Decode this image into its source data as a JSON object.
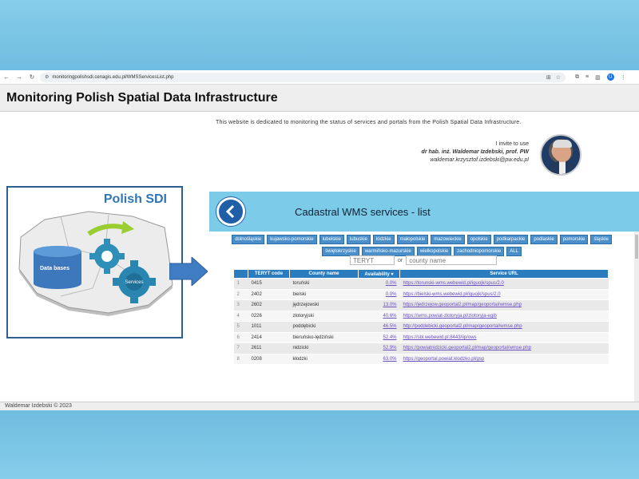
{
  "browser": {
    "url": "monitoringpolishsdi.cenagis.edu.pl/WMSServicesList.php",
    "profile_initial": "U"
  },
  "header": {
    "title": "Monitoring Polish Spatial Data Infrastructure"
  },
  "intro": {
    "text": "This website is dedicated to monitoring the status of services and portals from the Polish Spatial Data Infrastructure.",
    "invite": "I invite to use",
    "author": "dr hab. inż. Waldemar Izdebski, prof. PW",
    "email": "waldemar.krzysztof.izdebski@pw.edu.pl"
  },
  "sdi_graphic": {
    "title": "Polish SDI",
    "databases_label": "Data bases",
    "services_label": "Services"
  },
  "panel": {
    "title": "Cadastral WMS services - list",
    "voivodeships": [
      "dolnośląskie",
      "kujawsko-pomorskie",
      "lubelskie",
      "lubuskie",
      "łódzkie",
      "małopolskie",
      "mazowieckie",
      "opolskie",
      "podkarpackie",
      "podlaskie",
      "pomorskie",
      "śląskie",
      "świętokrzyskie",
      "warmińsko-mazurskie",
      "wielkopolskie",
      "zachodniopomorskie",
      "ALL"
    ],
    "search": {
      "teryt_placeholder": "TERYT",
      "or_label": "or",
      "county_placeholder": "county name"
    },
    "columns": [
      "",
      "TERYT code",
      "County name",
      "Availability ▾",
      "Service URL"
    ],
    "rows": [
      {
        "n": "1",
        "teryt": "0415",
        "county": "toruński",
        "avail": "0.0%",
        "url": "https://torunski-wms.webewid.pl/iguojk/spus/2.0"
      },
      {
        "n": "2",
        "teryt": "2402",
        "county": "bielski",
        "avail": "0.0%",
        "url": "https://bielski-wms.webewid.pl/iguojk/spus/2.0"
      },
      {
        "n": "3",
        "teryt": "2602",
        "county": "jędrzejowski",
        "avail": "13.0%",
        "url": "https://jedrzejow.geoportal2.pl/map/geoportal/wmse.php"
      },
      {
        "n": "4",
        "teryt": "0226",
        "county": "złotoryjski",
        "avail": "40.6%",
        "url": "https://wms.powiat-zlotoryja.pl/zlotoryja-egib"
      },
      {
        "n": "5",
        "teryt": "1011",
        "county": "poddębicki",
        "avail": "46.5%",
        "url": "http://poddebicki.geoportal2.pl/map/geoportal/wmse.php"
      },
      {
        "n": "6",
        "teryt": "2414",
        "county": "bieruńsko-lędziński",
        "avail": "52.4%",
        "url": "https://sbl.webewid.pl:8443/iip/ows"
      },
      {
        "n": "7",
        "teryt": "2611",
        "county": "nidzicki",
        "avail": "52.9%",
        "url": "https://powiatnidzicki.geoportal2.pl/map/geoportal/wmse.php"
      },
      {
        "n": "8",
        "teryt": "0208",
        "county": "kłodzki",
        "avail": "63.0%",
        "url": "https://geoportal.powiat.klodzko.pl/gsp"
      }
    ]
  },
  "footer": {
    "text": "Waldemar Izdebski © 2023"
  },
  "colors": {
    "accent": "#2b7bbf",
    "panel_header": "#7ccbe8",
    "link": "#6a4fc0"
  }
}
